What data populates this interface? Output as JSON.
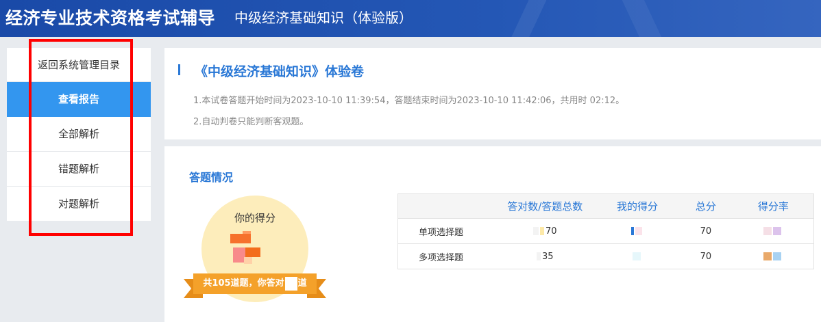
{
  "header": {
    "title": "经济专业技术资格考试辅导",
    "subtitle": "中级经济基础知识（体验版）"
  },
  "sidebar": {
    "items": [
      {
        "label": "返回系统管理目录"
      },
      {
        "label": "查看报告"
      },
      {
        "label": "全部解析"
      },
      {
        "label": "错题解析"
      },
      {
        "label": "对题解析"
      }
    ]
  },
  "info": {
    "title": "《中级经济基础知识》体验卷",
    "note1": "1.本试卷答题开始时间为2023-10-10 11:39:54，答题结束时间为2023-10-10 11:42:06，共用时 02:12。",
    "note2": "2.自动判卷只能判断客观题。"
  },
  "answer": {
    "section_title": "答题情况",
    "score_label": "你的得分",
    "ribbon_prefix": "共105道题，你答对",
    "ribbon_suffix": "道"
  },
  "table": {
    "headers": [
      "",
      "答对数/答题总数",
      "我的得分",
      "总分",
      "得分率"
    ],
    "rows": [
      {
        "type": "单项选择题",
        "ratio": "70",
        "total": "70"
      },
      {
        "type": "多项选择题",
        "ratio": "35",
        "total": "70"
      }
    ]
  },
  "colors": {
    "header_bg": "#2457b5",
    "accent": "#2a78d6",
    "active_item": "#3396ef",
    "score_circle": "#fdedbb",
    "ribbon": "#f4a12a",
    "highlight": "#ff0000"
  }
}
